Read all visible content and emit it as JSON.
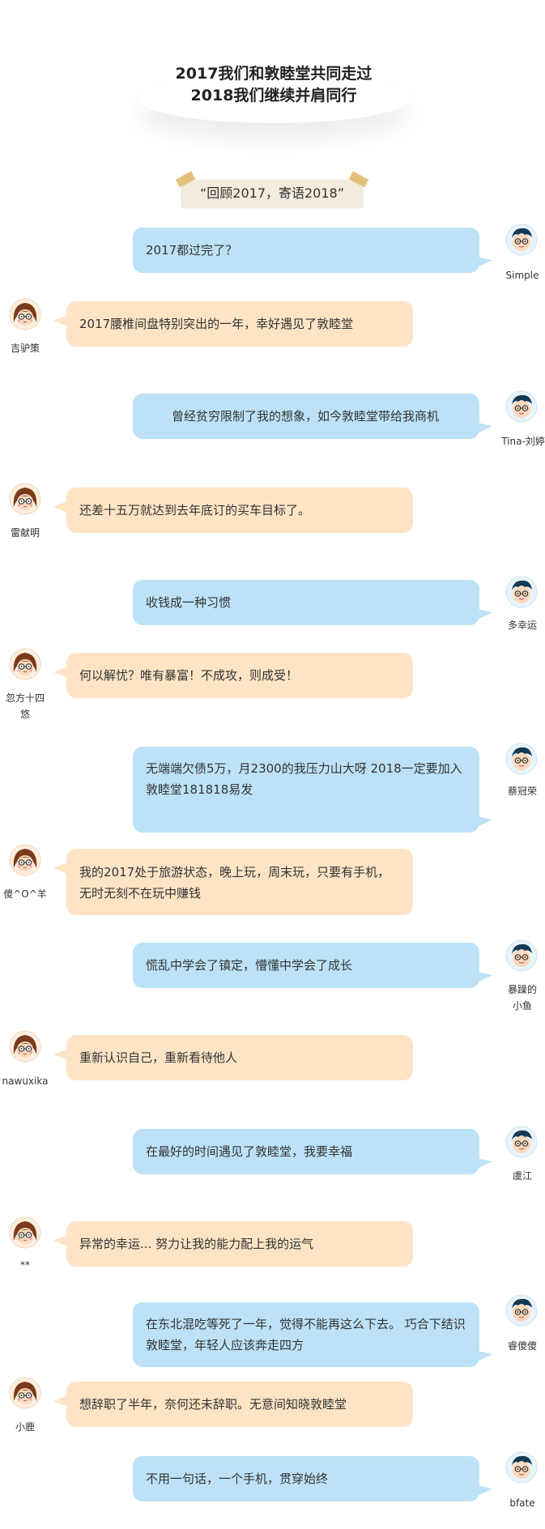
{
  "header": {
    "line1": "2017我们和敦睦堂共同走过",
    "line2": "2018我们继续并肩同行"
  },
  "banner": {
    "text": "“回顾2017，寄语2018”"
  },
  "colors": {
    "right_bubble": "#bde2f7",
    "left_bubble": "#fde4c5",
    "tape": "#f3ebdd"
  },
  "messages": [
    {
      "side": "right",
      "avatar": "boy-avatar-icon",
      "name": "Simple",
      "text": "2017都过完了？"
    },
    {
      "side": "left",
      "avatar": "girl-avatar-icon",
      "name": "吉驴策",
      "text": "2017腰椎间盘特别突出的一年，幸好遇见了敦睦堂"
    },
    {
      "side": "right",
      "avatar": "boy-avatar-icon",
      "name": "Tina-刘婷",
      "text": "曾经贫穷限制了我的想象，如今敦睦堂带给我商机"
    },
    {
      "side": "left",
      "avatar": "girl-avatar-icon",
      "name": "雷献明",
      "text": "还差十五万就达到去年底订的买车目标了。"
    },
    {
      "side": "right",
      "avatar": "boy-avatar-icon",
      "name": "多幸运",
      "text": "收钱成一种习惯"
    },
    {
      "side": "left",
      "avatar": "girl-avatar-icon",
      "name": "忽方十四悠",
      "text": "何以解忧？唯有暴富！不成攻，则成受！"
    },
    {
      "side": "right",
      "avatar": "boy-avatar-icon",
      "name": "蔡冠荣",
      "text": "无端端欠债5万，月2300的我压力山大呀 2018一定要加入敦睦堂181818易发"
    },
    {
      "side": "left",
      "avatar": "girl-avatar-icon",
      "name": "傻^O^羊",
      "text": "我的2017处于旅游状态，晚上玩，周末玩，只要有手机，无时无刻不在玩中赚钱"
    },
    {
      "side": "right",
      "avatar": "boy-avatar-icon",
      "name": "暴躁的小鱼",
      "text": "慌乱中学会了镇定，懵懂中学会了成长"
    },
    {
      "side": "left",
      "avatar": "girl-avatar-icon",
      "name": "nawuxika",
      "text": "重新认识自己，重新看待他人"
    },
    {
      "side": "right",
      "avatar": "boy-avatar-icon",
      "name": "虞江",
      "text": "在最好的时间遇见了敦睦堂，我要幸福"
    },
    {
      "side": "left",
      "avatar": "girl-avatar-icon",
      "name": "**",
      "text": "异常的幸运... 努力让我的能力配上我的运气"
    },
    {
      "side": "right",
      "avatar": "boy-avatar-icon",
      "name": "睿傻傻",
      "text": "在东北混吃等死了一年，觉得不能再这么下去。 巧合下结识敦睦堂，年轻人应该奔走四方"
    },
    {
      "side": "left",
      "avatar": "girl-avatar-icon",
      "name": "小鹿",
      "text": "想辞职了半年，奈何还未辞职。无意间知晓敦睦堂"
    },
    {
      "side": "right",
      "avatar": "boy-avatar-icon",
      "name": "bfate",
      "text": "不用一句话，一个手机，贯穿始终"
    }
  ]
}
